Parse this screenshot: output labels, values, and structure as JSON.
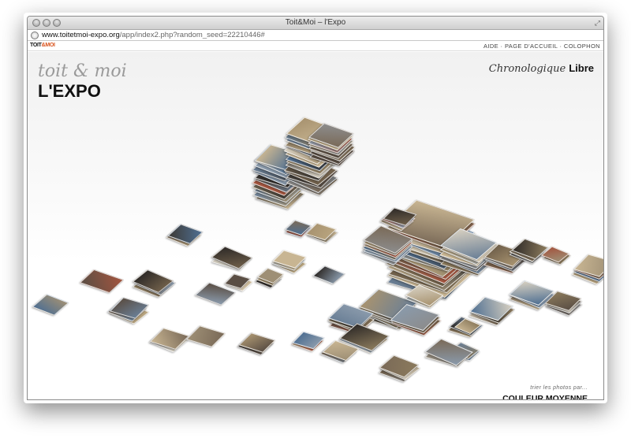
{
  "window": {
    "title": "Toit&Moi – l'Expo"
  },
  "urlbar": {
    "domain": "www.toitetmoi-expo.org",
    "path": "/app/index2.php?random_seed=22210446#"
  },
  "site": {
    "logo_part1": "TOIT",
    "logo_part2": "&MOI",
    "nav": [
      "AIDE",
      "PAGE D'ACCUEIL",
      "COLOPHON"
    ],
    "nav_separator": " · "
  },
  "header": {
    "title_small": "toit & moi",
    "title_big": "L'EXPO"
  },
  "mode": {
    "chrono": "Chronologique",
    "libre": "Libre"
  },
  "sort": {
    "caption": "trier les photos par...",
    "link": "COULEUR MOYENNE"
  },
  "colors": {
    "accent": "#d9541e"
  },
  "icons": {
    "globe": "globe-icon",
    "resize": "resize-icon"
  }
}
